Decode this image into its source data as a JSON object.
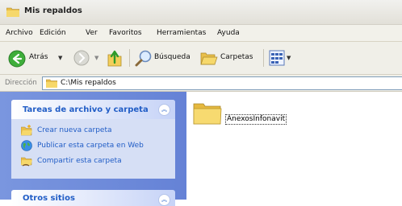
{
  "window": {
    "title": "Mis repaldos"
  },
  "menu": [
    "Archivo",
    "Edición",
    "Ver",
    "Favoritos",
    "Herramientas",
    "Ayuda"
  ],
  "toolbar": {
    "back_label": "Atrás",
    "search_label": "Búsqueda",
    "folders_label": "Carpetas"
  },
  "address": {
    "label": "Dirección",
    "path": "C:\\Mis repaldos"
  },
  "tasks": {
    "title": "Tareas de archivo y carpeta",
    "items": [
      {
        "label": "Crear nueva carpeta",
        "icon": "new-folder-icon"
      },
      {
        "label": "Publicar esta carpeta en Web",
        "icon": "globe-icon"
      },
      {
        "label": "Compartir esta carpeta",
        "icon": "share-folder-icon"
      }
    ]
  },
  "other_places": {
    "title": "Otros sitios"
  },
  "files": [
    {
      "name": "AnexosInfonavit",
      "icon": "folder-icon"
    }
  ],
  "colors": {
    "link": "#215dc6",
    "pane": "#7a96df",
    "folder": "#f6d86b"
  }
}
